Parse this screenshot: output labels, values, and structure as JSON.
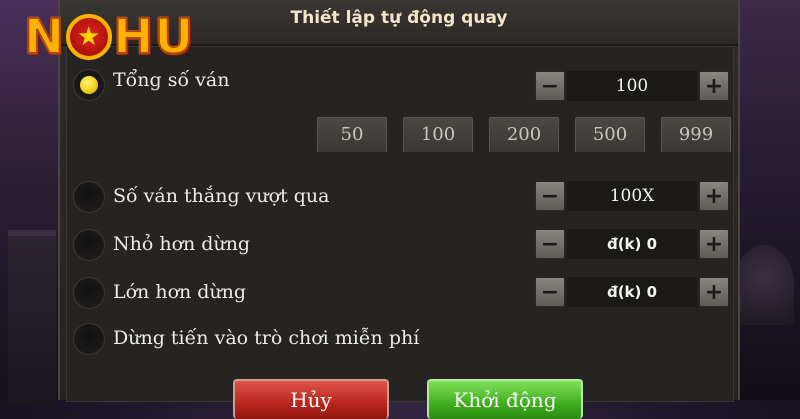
{
  "logo": {
    "letters": [
      "N",
      "H",
      "U"
    ],
    "star_glyph": "★"
  },
  "dialog": {
    "title": "Thiết lập tự động quay"
  },
  "total_spins": {
    "label": "Tổng số ván",
    "selected": true,
    "value": "100",
    "presets": [
      "50",
      "100",
      "200",
      "500",
      "999"
    ]
  },
  "rows": {
    "win_exceed": {
      "label": "Số ván thắng vượt qua",
      "value": "100X",
      "selected": false
    },
    "stop_below": {
      "label": "Nhỏ hơn dừng",
      "value": "đ(k) 0",
      "selected": false
    },
    "stop_above": {
      "label": "Lớn hơn dừng",
      "value": "đ(k) 0",
      "selected": false
    },
    "stop_free": {
      "label": "Dừng tiến vào trò chơi miễn phí",
      "selected": false
    }
  },
  "stepper": {
    "minus": "−",
    "plus": "+"
  },
  "buttons": {
    "cancel": "Hủy",
    "start": "Khởi động"
  },
  "colors": {
    "radio_selected": "#f4d21a",
    "cancel_button": "#c8362c",
    "start_button": "#45b324",
    "logo_gold": "#ffb300"
  }
}
